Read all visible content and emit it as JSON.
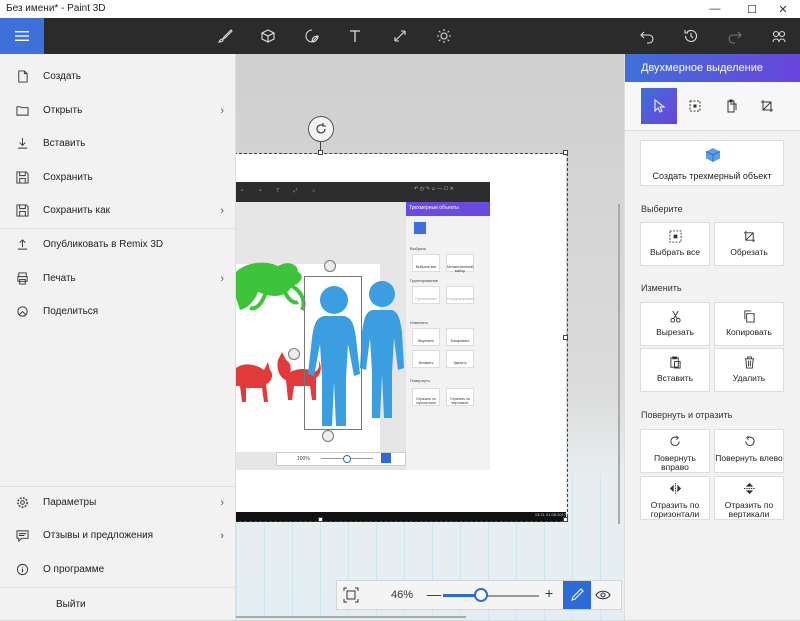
{
  "window": {
    "title": "Без имени* - Paint 3D",
    "minimize_glyph": "—",
    "maximize_glyph": "☐",
    "close_glyph": "✕"
  },
  "toolbar": {
    "tools": [
      "brush-icon",
      "cube-icon",
      "sticker-icon",
      "text-icon",
      "canvas-icon",
      "effects-icon"
    ],
    "undo_icon": "undo-icon",
    "history_icon": "history-icon",
    "redo_icon": "redo-icon",
    "remix_icon": "remix-icon"
  },
  "menu": {
    "items": [
      {
        "label": "Создать",
        "icon": "new-file-icon",
        "has_submenu": false
      },
      {
        "label": "Открыть",
        "icon": "folder-icon",
        "has_submenu": true
      },
      {
        "label": "Вставить",
        "icon": "insert-icon",
        "has_submenu": false
      },
      {
        "label": "Сохранить",
        "icon": "save-icon",
        "has_submenu": false
      },
      {
        "label": "Сохранить как",
        "icon": "save-as-icon",
        "has_submenu": true
      },
      {
        "label": "Опубликовать в Remix 3D",
        "icon": "upload-icon",
        "has_submenu": false
      },
      {
        "label": "Печать",
        "icon": "printer-icon",
        "has_submenu": true
      },
      {
        "label": "Поделиться",
        "icon": "share-icon",
        "has_submenu": false
      }
    ],
    "bottom_items": [
      {
        "label": "Параметры",
        "icon": "gear-icon",
        "has_submenu": true
      },
      {
        "label": "Отзывы и предложения",
        "icon": "feedback-icon",
        "has_submenu": true
      },
      {
        "label": "О программе",
        "icon": "info-icon",
        "has_submenu": false
      }
    ],
    "exit_label": "Выйти",
    "chevron": "›"
  },
  "canvas": {
    "zoom_percent": "46%",
    "zoom_value": 0.4,
    "zoom_minus": "—",
    "zoom_plus": "+",
    "inner_screenshot": {
      "panel_title": "Трехмерные объекты",
      "zoom": "100%",
      "time": "13:21",
      "date": "01.08.2017",
      "section_select": "Выбрать",
      "section_group": "Группирование",
      "section_edit": "Изменить",
      "section_rotate": "Повернуть",
      "buttons": [
        "Выбрать все",
        "Множественный выбор",
        "Группировать",
        "Разгруппировать",
        "Вырезать",
        "Копировать",
        "Вставить",
        "Удалить",
        "Отразить по горизонтали",
        "Отразить по вертикали"
      ]
    }
  },
  "right_panel": {
    "title": "Двухмерное выделение",
    "make_3d_label": "Создать трехмерный объект",
    "section_select": "Выберите",
    "select_all": "Выбрать все",
    "crop": "Обрезать",
    "section_edit": "Изменить",
    "cut": "Вырезать",
    "copy": "Копировать",
    "paste": "Вставить",
    "delete": "Удалить",
    "section_rotate": "Повернуть и отразить",
    "rotate_right": "Повернуть вправо",
    "rotate_left": "Повернуть влево",
    "flip_h": "Отразить по горизонтали",
    "flip_v": "Отразить по вертикали"
  },
  "colors": {
    "accent": "#2d6bd6",
    "accent_purple": "#6a44dc",
    "toolbar_bg": "#2b2b2b",
    "figure_blue": "#3a9ee0",
    "figure_green": "#3ec43a",
    "figure_red": "#e23a3a"
  }
}
